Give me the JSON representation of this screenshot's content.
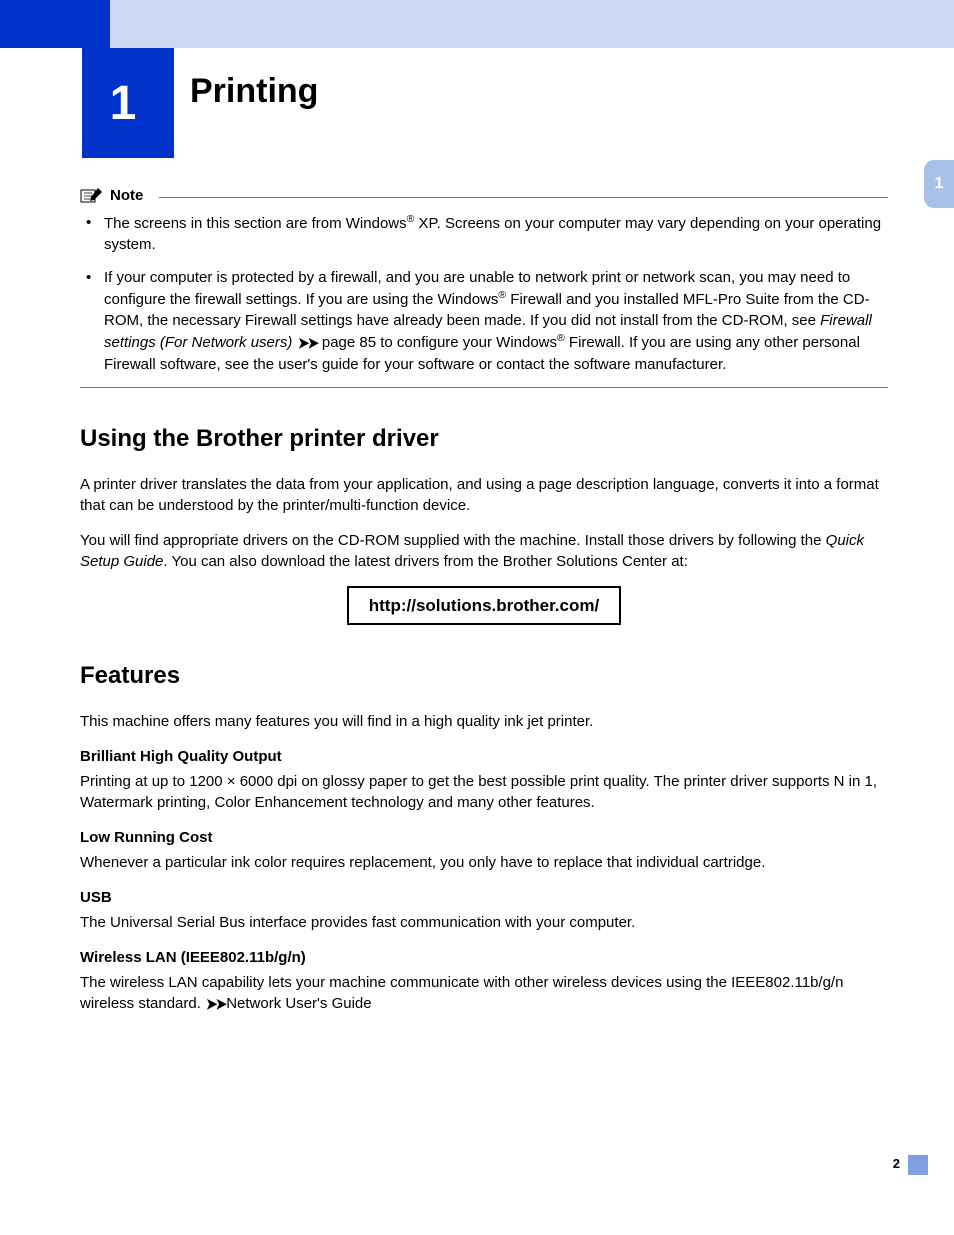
{
  "chapter": {
    "number": "1",
    "title": "Printing"
  },
  "sideTab": "1",
  "note": {
    "label": "Note",
    "items": {
      "a": {
        "pre": "The screens in this section are from Windows",
        "sup1": "®",
        "post": " XP. Screens on your computer may vary depending on your operating system."
      },
      "b": {
        "l1": "If your computer is protected by a firewall, and you are unable to network print or network scan, you may need to configure the firewall settings. If you are using the Windows",
        "sup1": "®",
        "l2": " Firewall and you installed MFL-Pro Suite from the CD-ROM, the necessary Firewall settings have already been made. If you did not install from the CD-ROM, see ",
        "xref": "Firewall settings (For Network users)",
        "arrows": "➤➤",
        "l3": " page 85 to configure your Windows",
        "sup2": "®",
        "l4": " Firewall. If you are using any other personal Firewall software, see the user's guide for your software or contact the software manufacturer."
      }
    }
  },
  "sec1": {
    "heading": "Using the Brother printer driver",
    "p1": "A printer driver translates the data from your application, and using a page description language, converts it into a format that can be understood by the printer/multi-function device.",
    "p2a": "You will find appropriate drivers on the CD-ROM supplied with the machine. Install those drivers by following the ",
    "p2_italic": "Quick Setup Guide",
    "p2b": ". You can also download the latest drivers from the Brother Solutions Center at:",
    "url": "http://solutions.brother.com/"
  },
  "sec2": {
    "heading": "Features",
    "intro": "This machine offers many features you will find in a high quality ink jet printer.",
    "f1h": "Brilliant High Quality Output",
    "f1b": "Printing at up to 1200 × 6000 dpi on glossy paper to get the best possible print quality. The printer driver supports N in 1, Watermark printing, Color Enhancement technology and many other features.",
    "f2h": "Low Running Cost",
    "f2b": "Whenever a particular ink color requires replacement, you only have to replace that individual cartridge.",
    "f3h": "USB",
    "f3b": "The Universal Serial Bus interface provides fast communication with your computer.",
    "f4h": "Wireless LAN (IEEE802.11b/g/n)",
    "f4b_pre": "The wireless LAN capability lets your machine communicate with other wireless devices using the IEEE802.11b/g/n wireless standard. ",
    "f4b_arrows": "➤➤",
    "f4b_post": "Network User's Guide"
  },
  "pageNumber": "2"
}
